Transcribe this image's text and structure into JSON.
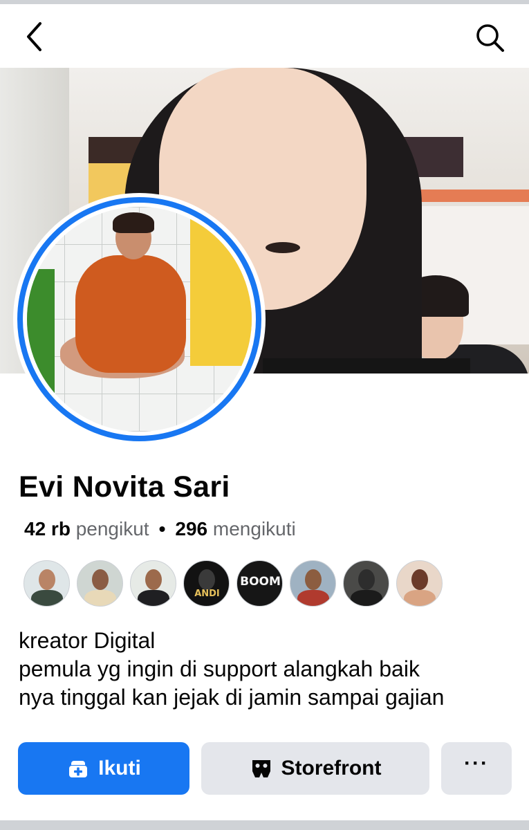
{
  "header": {
    "back_icon": "chevron-left-icon",
    "search_icon": "search-icon"
  },
  "profile": {
    "name": "Evi Novita Sari",
    "followers_count": "42 rb",
    "followers_label": "pengikut",
    "separator": "•",
    "following_count": "296",
    "following_label": "mengikuti"
  },
  "friends": [
    {
      "text": ""
    },
    {
      "text": ""
    },
    {
      "text": ""
    },
    {
      "text": "ANDI"
    },
    {
      "text": "BOOM"
    },
    {
      "text": ""
    },
    {
      "text": ""
    },
    {
      "text": ""
    }
  ],
  "bio": {
    "line1": "kreator Digital",
    "line2": "pemula yg ingin di support alangkah baik",
    "line3": "nya tinggal kan jejak di jamin sampai gajian"
  },
  "actions": {
    "follow_label": "Ikuti",
    "storefront_label": "Storefront",
    "more_label": "···"
  },
  "colors": {
    "primary": "#1877f2",
    "secondary_button": "#e4e6eb",
    "muted_text": "#65676b"
  }
}
